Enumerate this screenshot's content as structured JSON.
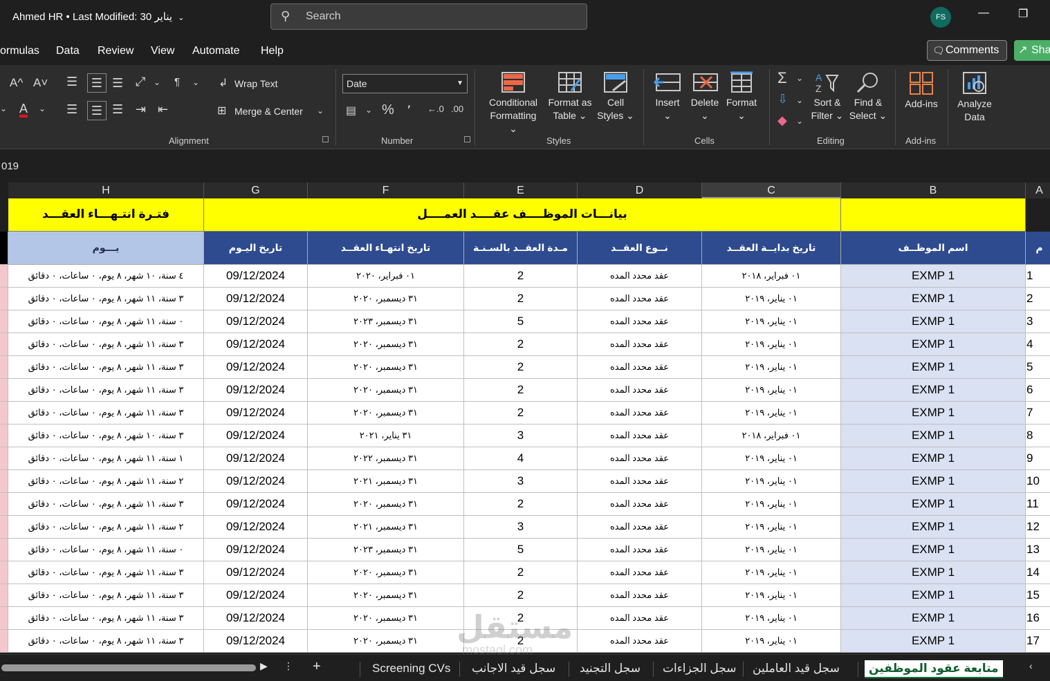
{
  "titlebar": {
    "doc_title": "Ahmed HR",
    "modified": "Last Modified: 30 يناير",
    "search_placeholder": "Search",
    "avatar": "FS"
  },
  "menu": [
    "ormulas",
    "Data",
    "Review",
    "View",
    "Automate",
    "Help"
  ],
  "actions": {
    "comments": "Comments",
    "share": "Sha"
  },
  "ribbon": {
    "alignment": {
      "wrap_text": "Wrap Text",
      "merge_center": "Merge & Center",
      "label": "Alignment"
    },
    "number": {
      "format": "Date",
      "label": "Number"
    },
    "styles": {
      "conditional": [
        "Conditional",
        "Formatting ⌄"
      ],
      "format_table": [
        "Format as",
        "Table ⌄"
      ],
      "cell_styles": [
        "Cell",
        "Styles ⌄"
      ],
      "label": "Styles"
    },
    "cells": {
      "insert": "Insert",
      "delete": "Delete",
      "format": "Format",
      "label": "Cells"
    },
    "editing": {
      "sort": [
        "Sort &",
        "Filter ⌄"
      ],
      "find": [
        "Find &",
        "Select ⌄"
      ],
      "label": "Editing"
    },
    "addins": {
      "addins": "Add-ins",
      "label": "Add-ins"
    },
    "analyze": [
      "Analyze",
      "Data"
    ]
  },
  "formula_bar": {
    "value": "019"
  },
  "columns": [
    "H",
    "G",
    "F",
    "E",
    "D",
    "C",
    "B",
    "A"
  ],
  "banner": {
    "left": "فتـرة انتـهـــاء العقـــد",
    "main": "بيانـــات الموظــــف عقــــد العمــــل"
  },
  "headers": {
    "h": "يـــوم",
    "g": "تاريخ اليـوم",
    "f": "تاريخ انتهـاء العقــد",
    "e": "مـدة العقــد بالسـنـة",
    "d": "نــوع العقــد",
    "c": "تاريخ بدايــة العقــد",
    "b": "اسم الموظــف",
    "a": "م"
  },
  "rows": [
    {
      "h": "٤ سنة، ١٠ شهر، ٨ يوم، ٠ ساعات، ٠ دقائق",
      "g": "09/12/2024",
      "f": "٠١ فبراير، ٢٠٢٠",
      "e": "2",
      "d": "عقد محدد المده",
      "c": "٠١ فبراير، ٢٠١٨",
      "b": "EXMP 1",
      "a": "1"
    },
    {
      "h": "٣ سنة، ١١ شهر، ٨ يوم، ٠ ساعات، ٠ دقائق",
      "g": "09/12/2024",
      "f": "٣١ ديسمبر، ٢٠٢٠",
      "e": "2",
      "d": "عقد محدد المده",
      "c": "٠١ يناير، ٢٠١٩",
      "b": "EXMP 1",
      "a": "2"
    },
    {
      "h": "٠ سنة، ١١ شهر، ٨ يوم، ٠ ساعات، ٠ دقائق",
      "g": "09/12/2024",
      "f": "٣١ ديسمبر، ٢٠٢٣",
      "e": "5",
      "d": "عقد محدد المده",
      "c": "٠١ يناير، ٢٠١٩",
      "b": "EXMP 1",
      "a": "3"
    },
    {
      "h": "٣ سنة، ١١ شهر، ٨ يوم، ٠ ساعات، ٠ دقائق",
      "g": "09/12/2024",
      "f": "٣١ ديسمبر، ٢٠٢٠",
      "e": "2",
      "d": "عقد محدد المده",
      "c": "٠١ يناير، ٢٠١٩",
      "b": "EXMP 1",
      "a": "4"
    },
    {
      "h": "٣ سنة، ١١ شهر، ٨ يوم، ٠ ساعات، ٠ دقائق",
      "g": "09/12/2024",
      "f": "٣١ ديسمبر، ٢٠٢٠",
      "e": "2",
      "d": "عقد محدد المده",
      "c": "٠١ يناير، ٢٠١٩",
      "b": "EXMP 1",
      "a": "5"
    },
    {
      "h": "٣ سنة، ١١ شهر، ٨ يوم، ٠ ساعات، ٠ دقائق",
      "g": "09/12/2024",
      "f": "٣١ ديسمبر، ٢٠٢٠",
      "e": "2",
      "d": "عقد محدد المده",
      "c": "٠١ يناير، ٢٠١٩",
      "b": "EXMP 1",
      "a": "6"
    },
    {
      "h": "٣ سنة، ١١ شهر، ٨ يوم، ٠ ساعات، ٠ دقائق",
      "g": "09/12/2024",
      "f": "٣١ ديسمبر، ٢٠٢٠",
      "e": "2",
      "d": "عقد محدد المده",
      "c": "٠١ يناير، ٢٠١٩",
      "b": "EXMP 1",
      "a": "7"
    },
    {
      "h": "٣ سنة، ١٠ شهر، ٨ يوم، ٠ ساعات، ٠ دقائق",
      "g": "09/12/2024",
      "f": "٣١ يناير، ٢٠٢١",
      "e": "3",
      "d": "عقد محدد المده",
      "c": "٠١ فبراير، ٢٠١٨",
      "b": "EXMP 1",
      "a": "8"
    },
    {
      "h": "١ سنة، ١١ شهر، ٨ يوم، ٠ ساعات، ٠ دقائق",
      "g": "09/12/2024",
      "f": "٣١ ديسمبر، ٢٠٢٢",
      "e": "4",
      "d": "عقد محدد المده",
      "c": "٠١ يناير، ٢٠١٩",
      "b": "EXMP 1",
      "a": "9"
    },
    {
      "h": "٢ سنة، ١١ شهر، ٨ يوم، ٠ ساعات، ٠ دقائق",
      "g": "09/12/2024",
      "f": "٣١ ديسمبر، ٢٠٢١",
      "e": "3",
      "d": "عقد محدد المده",
      "c": "٠١ يناير، ٢٠١٩",
      "b": "EXMP 1",
      "a": "10"
    },
    {
      "h": "٣ سنة، ١١ شهر، ٨ يوم، ٠ ساعات، ٠ دقائق",
      "g": "09/12/2024",
      "f": "٣١ ديسمبر، ٢٠٢٠",
      "e": "2",
      "d": "عقد محدد المده",
      "c": "٠١ يناير، ٢٠١٩",
      "b": "EXMP 1",
      "a": "11"
    },
    {
      "h": "٢ سنة، ١١ شهر، ٨ يوم، ٠ ساعات، ٠ دقائق",
      "g": "09/12/2024",
      "f": "٣١ ديسمبر، ٢٠٢١",
      "e": "3",
      "d": "عقد محدد المده",
      "c": "٠١ يناير، ٢٠١٩",
      "b": "EXMP 1",
      "a": "12"
    },
    {
      "h": "٠ سنة، ١١ شهر، ٨ يوم، ٠ ساعات، ٠ دقائق",
      "g": "09/12/2024",
      "f": "٣١ ديسمبر، ٢٠٢٣",
      "e": "5",
      "d": "عقد محدد المده",
      "c": "٠١ يناير، ٢٠١٩",
      "b": "EXMP 1",
      "a": "13"
    },
    {
      "h": "٣ سنة، ١١ شهر، ٨ يوم، ٠ ساعات، ٠ دقائق",
      "g": "09/12/2024",
      "f": "٣١ ديسمبر، ٢٠٢٠",
      "e": "2",
      "d": "عقد محدد المده",
      "c": "٠١ يناير، ٢٠١٩",
      "b": "EXMP 1",
      "a": "14"
    },
    {
      "h": "٣ سنة، ١١ شهر، ٨ يوم، ٠ ساعات، ٠ دقائق",
      "g": "09/12/2024",
      "f": "٣١ ديسمبر، ٢٠٢٠",
      "e": "2",
      "d": "عقد محدد المده",
      "c": "٠١ يناير، ٢٠١٩",
      "b": "EXMP 1",
      "a": "15"
    },
    {
      "h": "٣ سنة، ١١ شهر، ٨ يوم، ٠ ساعات، ٠ دقائق",
      "g": "09/12/2024",
      "f": "٣١ ديسمبر، ٢٠٢٠",
      "e": "2",
      "d": "عقد محدد المده",
      "c": "٠١ يناير، ٢٠١٩",
      "b": "EXMP 1",
      "a": "16"
    },
    {
      "h": "٣ سنة، ١١ شهر، ٨ يوم، ٠ ساعات، ٠ دقائق",
      "g": "09/12/2024",
      "f": "٣١ ديسمبر، ٢٠٢٠",
      "e": "2",
      "d": "عقد محدد المده",
      "c": "٠١ يناير، ٢٠١٩",
      "b": "EXMP 1",
      "a": "17"
    }
  ],
  "sheet_tabs": [
    "Screening CVs",
    "سجل قيد الاجانب",
    "سجل التجنيد",
    "سجل الجزاءات",
    "سجل  قيد العاملين",
    "متابعة عقود الموظفين"
  ],
  "watermark": {
    "main": "مستقل",
    "sub": "mostaql.com"
  }
}
